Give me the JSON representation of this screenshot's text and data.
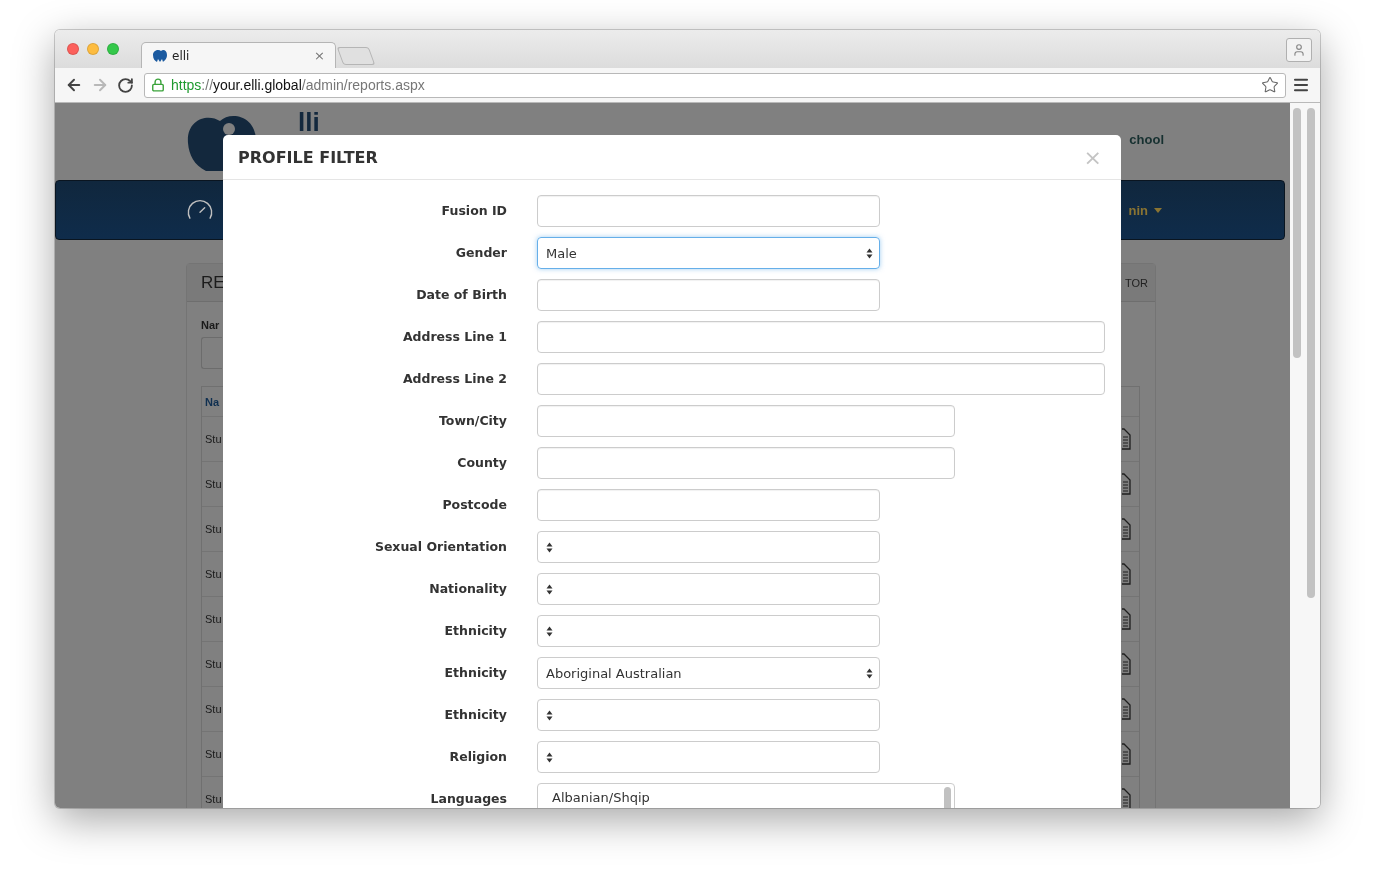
{
  "browser": {
    "tab": {
      "title": "elli",
      "close": "×"
    },
    "nav_buttons": [
      {
        "kind": "back",
        "disabled": false
      },
      {
        "kind": "forward",
        "disabled": true
      },
      {
        "kind": "reload",
        "disabled": false
      }
    ],
    "address": {
      "scheme": "https",
      "separator": "://",
      "host": "your.elli.global",
      "path": "/admin/reports.aspx"
    }
  },
  "page": {
    "logo_text": "lli",
    "school_text": "chool",
    "nav_menu": "nin",
    "panel": {
      "title": "RE",
      "action": "TOR",
      "filter_label": "Nar",
      "table_header": "Na",
      "rows": [
        "Stu",
        "Stu",
        "Stu",
        "Stu",
        "Stu",
        "Stu",
        "Stu",
        "Stu",
        "Stu"
      ]
    }
  },
  "modal": {
    "title": "PROFILE FILTER",
    "close": "×",
    "fields": [
      {
        "label": "Fusion ID",
        "kind": "text",
        "focused": false
      },
      {
        "label": "Gender",
        "kind": "select",
        "value": "Male",
        "focused": true
      },
      {
        "label": "Date of Birth",
        "kind": "text",
        "focused": false
      },
      {
        "label": "Address Line 1",
        "kind": "widetext",
        "focused": false
      },
      {
        "label": "Address Line 2",
        "kind": "widetext",
        "focused": false
      },
      {
        "label": "Town/City",
        "kind": "midtext",
        "focused": false
      },
      {
        "label": "County",
        "kind": "midtext",
        "focused": false
      },
      {
        "label": "Postcode",
        "kind": "text",
        "focused": false
      },
      {
        "label": "Sexual Orientation",
        "kind": "select",
        "focused": false
      },
      {
        "label": "Nationality",
        "kind": "select",
        "focused": false
      },
      {
        "label": "Ethnicity",
        "kind": "select",
        "focused": false
      },
      {
        "label": "Ethnicity",
        "kind": "select",
        "value": "Aboriginal Australian",
        "focused": false
      },
      {
        "label": "Ethnicity",
        "kind": "select",
        "focused": false
      },
      {
        "label": "Religion",
        "kind": "select",
        "focused": false
      },
      {
        "label": "Languages",
        "kind": "listbox",
        "focused": false,
        "options": [
          {
            "label": "Albanian/Shqip",
            "selected": false
          }
        ]
      }
    ]
  }
}
